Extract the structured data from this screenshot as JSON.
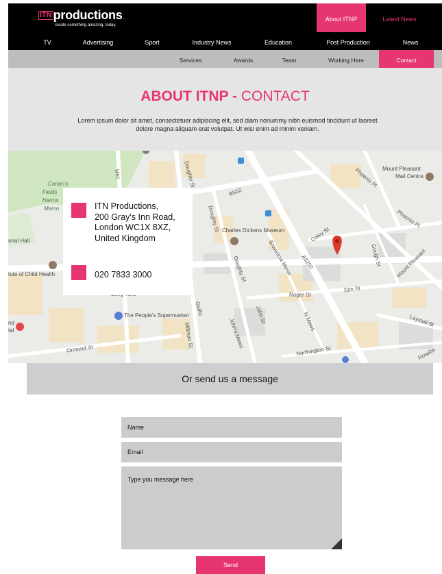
{
  "header": {
    "logo_mark": "ITN",
    "logo_word": "productions",
    "tagline": "create something amazing. today.",
    "top_links": [
      "About ITNP",
      "Latest News"
    ]
  },
  "main_nav": [
    "TV",
    "Advertising",
    "Sport",
    "Industry News",
    "Education",
    "Post Production",
    "News"
  ],
  "sub_nav": [
    "Services",
    "Awards",
    "Team",
    "Working Here",
    "Contact"
  ],
  "intro": {
    "title_strong": "ABOUT ITNP - ",
    "title_light": "CONTACT",
    "body": "Lorem ipsum dolor sit amet, consectetuer adipiscing elit, sed diam nonummy nibh euismod tincidunt ut laoreet dolore magna aliquam erat volutpat. Ut wisi enim ad minim veniam."
  },
  "map": {
    "labels": {
      "corams": "Coram's",
      "fields": "Fields",
      "harms": "Harms",
      "memo": "Memo",
      "national_hall": "onal Hall",
      "child_health": "tute of Child Health",
      "hospital_a": "nd",
      "hospital_b": "tal",
      "mount_pleasant_1": "Mount Pleasant",
      "mount_pleasant_2": "Mail Centre",
      "dickens": "Charles Dickens Museum",
      "supermarket": "The People's Supermarket",
      "b502": "B502",
      "a5200": "A5200",
      "doughty_1": "Doughty St",
      "doughty_2": "Doughty St",
      "doughty_3": "Doughty St",
      "brownlow": "Brownlow Mews",
      "roger": "Roger St",
      "elm": "Elm St",
      "laystall": "Laystall St",
      "coley": "Coley St",
      "gough": "Gough St",
      "phoenix_1": "Phoenix Pl",
      "phoenix_2": "Phoenix Pl",
      "mount_pleasant_st": "Mount Pleasant",
      "northington": "Northington St",
      "john": "John St",
      "johns_mews": "John's Mews",
      "millman": "Millman St",
      "ormond": "Ormond St",
      "long_yard": "Long Yard",
      "n_mews": "N Mews",
      "rosebery": "Rosebe",
      "guilford": "Guilfo",
      "mec": "Mec"
    },
    "address_lines": [
      "ITN Productions,",
      "200 Gray's Inn Road,",
      "London WC1X 8XZ,",
      "United Kingdom"
    ],
    "phone": "020 7833 3000"
  },
  "message_band": "Or send us a message",
  "form": {
    "name_placeholder": "Name",
    "email_placeholder": "Email",
    "message_placeholder": "Type you message here",
    "send_label": "Send"
  },
  "colors": {
    "accent": "#e6356f",
    "header_bg": "#000000",
    "subnav_bg": "#bcbdbd",
    "field_bg": "#cbcdcd"
  }
}
